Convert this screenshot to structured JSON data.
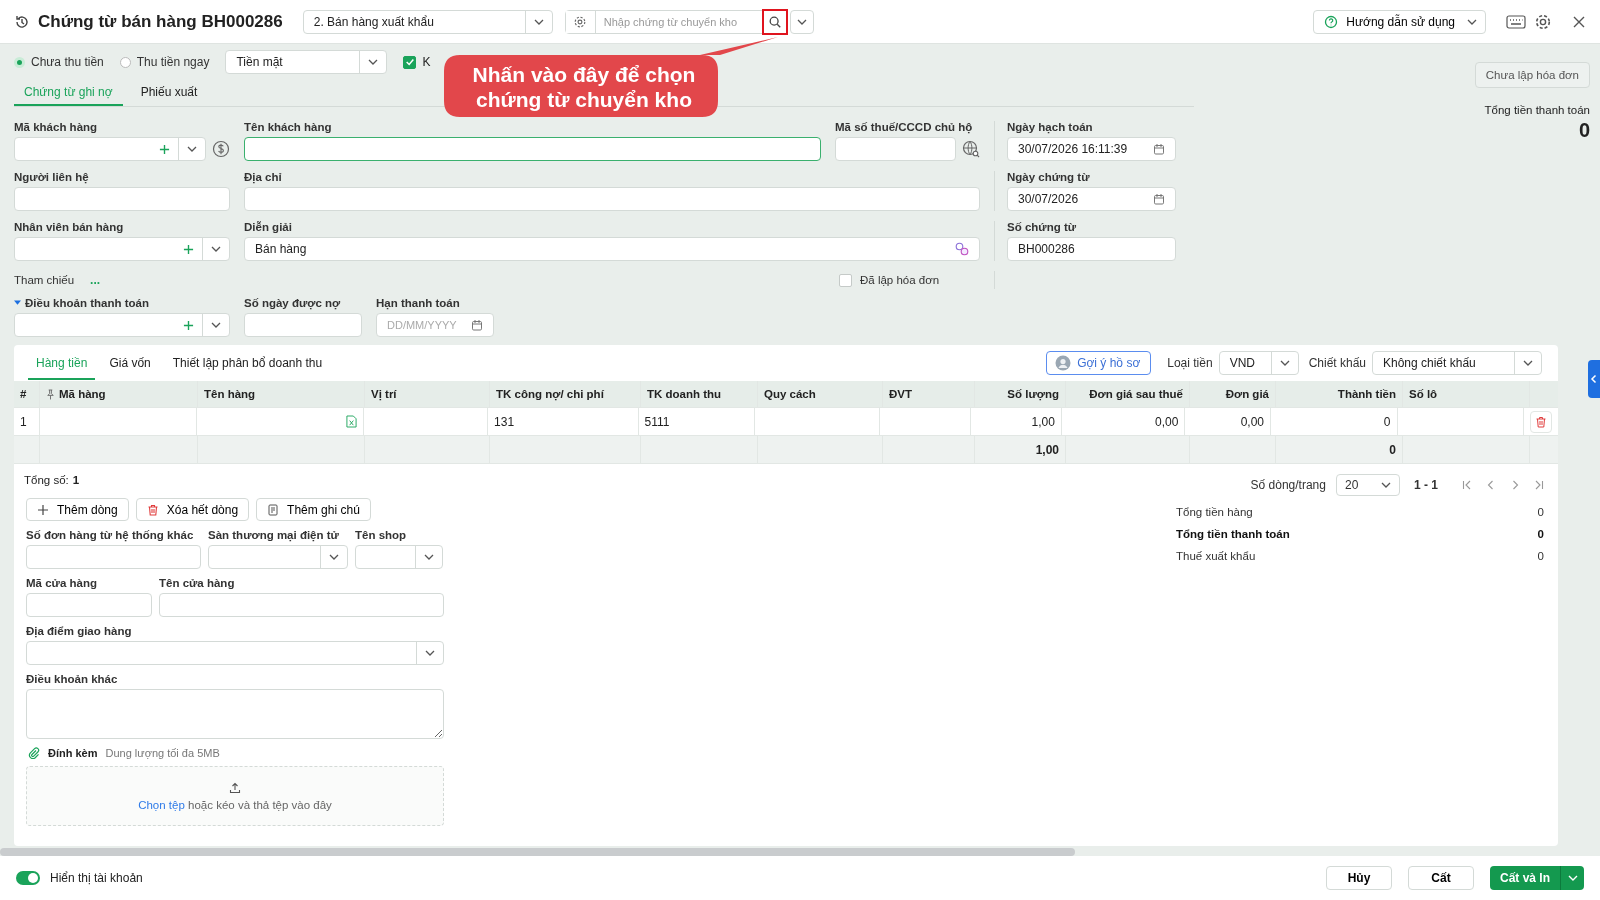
{
  "header": {
    "title": "Chứng từ bán hàng BH000286",
    "voucher_type": "2. Bán hàng xuất khẩu",
    "transfer_search": {
      "placeholder": "Nhập chứng từ chuyển kho"
    },
    "help_button": "Hướng dẫn sử dụng"
  },
  "payment": {
    "options": [
      {
        "label": "Chưa thu tiền",
        "selected": true
      },
      {
        "label": "Thu tiền ngay",
        "selected": false
      }
    ],
    "method": "Tiền mặt",
    "checkbox": {
      "label": "K",
      "checked": true
    }
  },
  "callout": "Nhấn vào đây để chọn chứng từ chuyển kho",
  "doc_tabs": [
    {
      "label": "Chứng từ ghi nợ",
      "selected": true
    },
    {
      "label": "Phiếu xuất",
      "selected": false
    }
  ],
  "invoice_status": "Chưa lập hóa đơn",
  "total_top": {
    "label": "Tổng tiền thanh toán",
    "value": "0"
  },
  "customer": {
    "code_label": "Mã khách hàng",
    "name_label": "Tên khách hàng",
    "tax_label": "Mã số thuế/CCCD chủ hộ",
    "contact_label": "Người liên hệ",
    "address_label": "Địa chỉ",
    "staff_label": "Nhân viên bán hàng",
    "desc_label": "Diễn giải",
    "desc_value": "Bán hàng",
    "ref_label": "Tham chiếu",
    "ref_more": "...",
    "invoiced": {
      "label": "Đã lập hóa đơn",
      "checked": false
    },
    "terms_label": "Điều khoản thanh toán",
    "terms_expanded": true,
    "days_label": "Số ngày được nợ",
    "due_label": "Hạn thanh toán",
    "due_placeholder": "DD/MM/YYYY"
  },
  "dates": {
    "posting_label": "Ngày hạch toán",
    "posting_value": "30/07/2026 16:11:39",
    "doc_date_label": "Ngày chứng từ",
    "doc_date_value": "30/07/2026",
    "doc_no_label": "Số chứng từ",
    "doc_no_value": "BH000286"
  },
  "grid_tabs": [
    {
      "label": "Hàng tiền",
      "selected": true
    },
    {
      "label": "Giá vốn",
      "selected": false
    },
    {
      "label": "Thiết lập phân bổ doanh thu",
      "selected": false
    }
  ],
  "profile_button": "Gợi ý hồ sơ",
  "currency_label": "Loại tiền",
  "currency": "VND",
  "discount_label": "Chiết khấu",
  "discount": "Không chiết khấu",
  "table": {
    "columns": [
      "#",
      "Mã hàng",
      "Tên hàng",
      "Vị trí",
      "TK công nợ/ chi phí",
      "TK doanh thu",
      "Quy cách",
      "ĐVT",
      "Số lượng",
      "Đơn giá sau thuế",
      "Đơn giá",
      "Thành tiền",
      "Số lô"
    ],
    "rows": [
      {
        "no": "1",
        "debit_account": "131",
        "revenue_account": "5111",
        "quantity": "1,00",
        "price_after_tax": "0,00",
        "price": "0,00",
        "amount": "0"
      }
    ],
    "totals": {
      "quantity": "1,00",
      "amount": "0"
    }
  },
  "total_count": {
    "label": "Tổng số:",
    "value": "1"
  },
  "pager": {
    "rows_label": "Số dòng/trang",
    "page_size": "20",
    "range": "1 - 1"
  },
  "actions": [
    {
      "kind": "add",
      "label": "Thêm dòng"
    },
    {
      "kind": "delete",
      "label": "Xóa hết dòng"
    },
    {
      "kind": "note",
      "label": "Thêm ghi chú"
    }
  ],
  "extra": {
    "order_no_label": "Số đơn hàng từ hệ thống khác",
    "marketplace_label": "Sàn thương mại điện tử",
    "shop_label": "Tên shop",
    "store_code_label": "Mã cửa hàng",
    "store_name_label": "Tên cửa hàng",
    "delivery_label": "Địa điểm giao hàng",
    "other_terms_label": "Điều khoản khác"
  },
  "attachment": {
    "label": "Đính kèm",
    "hint": "Dung lượng tối đa 5MB",
    "choose": "Chọn tệp",
    "drop_text": "hoặc kéo và thả tệp vào đây"
  },
  "summary": [
    {
      "label": "Tổng tiền hàng",
      "value": "0",
      "bold": false
    },
    {
      "label": "Tổng tiền thanh toán",
      "value": "0",
      "bold": true
    },
    {
      "label": "Thuế xuất khẩu",
      "value": "0",
      "bold": false
    }
  ],
  "footer": {
    "show_accounts": {
      "label": "Hiển thị tài khoản",
      "on": true
    },
    "buttons": [
      {
        "label": "Hủy",
        "kind": "secondary"
      },
      {
        "label": "Cất",
        "kind": "secondary"
      },
      {
        "label": "Cất và In",
        "kind": "primary"
      }
    ]
  }
}
